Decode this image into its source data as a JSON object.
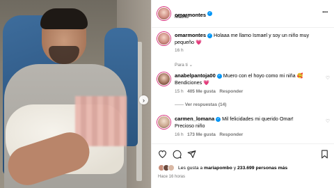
{
  "post": {
    "author": "omarmontes",
    "location": "Madrid",
    "caption_author": "omarmontes",
    "caption": "Holaaa me llamo Ismael y soy un niño muy pequeño 💗",
    "caption_time": "16 h",
    "more_icon": "more-options-icon"
  },
  "for_you_label": "Para ti",
  "comments": [
    {
      "user": "anabelpantoja00",
      "text": "Muero con el hoyo como mi niña 🥰 Bendiciones 💗",
      "time": "15 h",
      "likes": "405 Me gusta",
      "reply": "Responder",
      "view_replies": "Ver respuestas (14)"
    },
    {
      "user": "carmen_lomana",
      "text": "Mil felicidades mi querido Omar! Precioso niño",
      "time": "16 h",
      "likes": "173 Me gusta",
      "reply": "Responder"
    }
  ],
  "footer": {
    "likes_prefix": "Les gusta a ",
    "likes_user": "mariapombo",
    "likes_suffix": " y ",
    "likes_count": "233.699 personas más",
    "time_ago": "Hace 16 horas"
  },
  "colors": {
    "verified": "#0095f6",
    "heart": "#ed4956",
    "muted": "#737373"
  }
}
